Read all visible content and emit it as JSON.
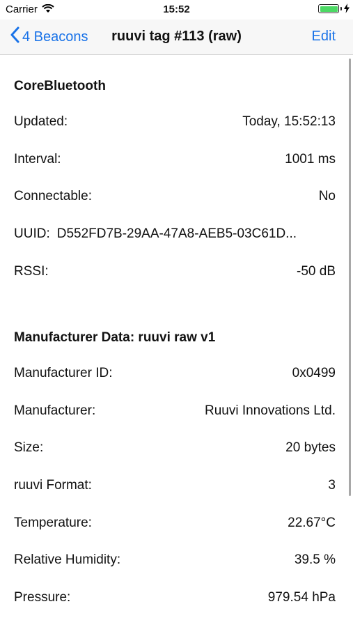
{
  "status_bar": {
    "carrier": "Carrier",
    "time": "15:52"
  },
  "nav": {
    "back_label": "4 Beacons",
    "title": "ruuvi tag #113 (raw)",
    "edit_label": "Edit"
  },
  "corebluetooth": {
    "header": "CoreBluetooth",
    "rows": [
      {
        "label": "Updated:",
        "value": "Today, 15:52:13"
      },
      {
        "label": "Interval:",
        "value": "1001 ms"
      },
      {
        "label": "Connectable:",
        "value": "No"
      },
      {
        "label": "UUID:",
        "value": "D552FD7B-29AA-47A8-AEB5-03C61D..."
      },
      {
        "label": "RSSI:",
        "value": "-50 dB"
      }
    ]
  },
  "manufacturer": {
    "header": "Manufacturer Data: ruuvi raw v1",
    "rows": [
      {
        "label": "Manufacturer ID:",
        "value": "0x0499"
      },
      {
        "label": "Manufacturer:",
        "value": "Ruuvi Innovations Ltd."
      },
      {
        "label": "Size:",
        "value": "20 bytes"
      },
      {
        "label": "ruuvi Format:",
        "value": "3"
      },
      {
        "label": "Temperature:",
        "value": "22.67°C"
      },
      {
        "label": "Relative Humidity:",
        "value": "39.5 %"
      },
      {
        "label": "Pressure:",
        "value": "979.54 hPa"
      }
    ]
  },
  "colors": {
    "accent": "#1a73e8",
    "battery": "#4cd964"
  }
}
